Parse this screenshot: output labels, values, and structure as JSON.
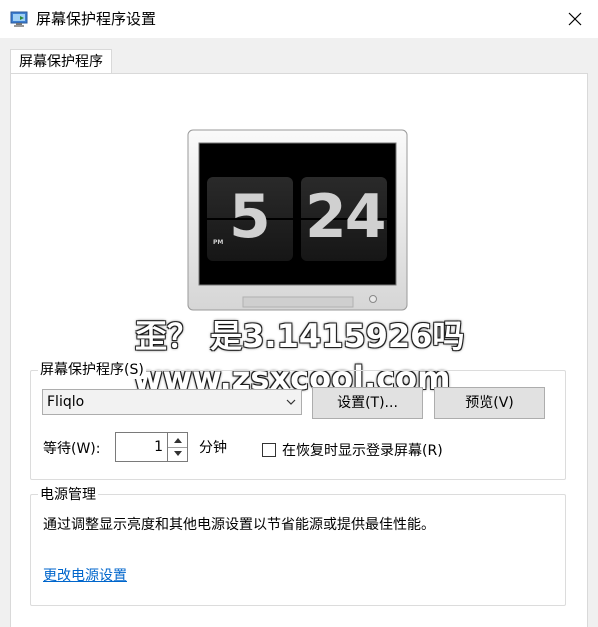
{
  "window": {
    "title": "屏幕保护程序设置",
    "close_icon": "close-icon",
    "app_icon": "monitor-settings-icon"
  },
  "tabs": [
    {
      "label": "屏幕保护程序",
      "selected": true
    }
  ],
  "preview": {
    "clock_hour": "5",
    "clock_minute": "24",
    "clock_period": "PM"
  },
  "watermark": {
    "line1": "歪？ 是3.1415926吗",
    "line2": "www.zsxcool.com"
  },
  "screensaver_group": {
    "label": "屏幕保护程序(S)",
    "selected": "Fliqlo",
    "settings_button": "设置(T)...",
    "preview_button": "预览(V)",
    "wait_label": "等待(W):",
    "wait_value": "1",
    "minutes_label": "分钟",
    "resume_checkbox_label": "在恢复时显示登录屏幕(R)",
    "resume_checked": false
  },
  "power_group": {
    "label": "电源管理",
    "description": "通过调整显示亮度和其他电源设置以节省能源或提供最佳性能。",
    "link": "更改电源设置"
  },
  "colors": {
    "link": "#0066cc",
    "window_bg": "#f0f0f0",
    "panel_bg": "#ffffff",
    "button_bg": "#e1e1e1"
  }
}
